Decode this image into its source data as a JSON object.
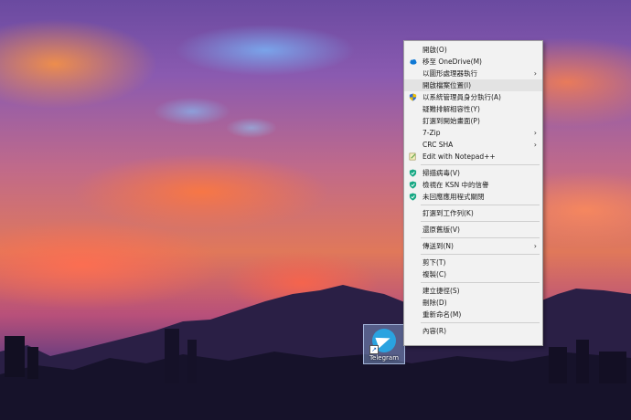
{
  "desktop": {
    "icon_label": "Telegram"
  },
  "context_menu": {
    "items": [
      {
        "label": "開啟(O)",
        "type": "item"
      },
      {
        "label": "移至 OneDrive(M)",
        "type": "item",
        "icon": "onedrive-cloud-icon"
      },
      {
        "label": "以圖形處理器執行",
        "type": "item",
        "submenu": true
      },
      {
        "label": "開啟檔案位置(I)",
        "type": "item",
        "highlight": true
      },
      {
        "label": "以系統管理員身分執行(A)",
        "type": "item",
        "icon": "uac-shield-icon"
      },
      {
        "label": "疑難排解相容性(Y)",
        "type": "item"
      },
      {
        "label": "釘選到開始畫面(P)",
        "type": "item"
      },
      {
        "label": "7-Zip",
        "type": "item",
        "submenu": true
      },
      {
        "label": "CRC SHA",
        "type": "item",
        "submenu": true
      },
      {
        "label": "Edit with Notepad++",
        "type": "item",
        "icon": "notepad-plus-plus-icon"
      },
      {
        "type": "separator"
      },
      {
        "label": "掃描病毒(V)",
        "type": "item",
        "icon": "kaspersky-shield-icon"
      },
      {
        "label": "檢視在 KSN 中的信譽",
        "type": "item",
        "icon": "kaspersky-shield-icon"
      },
      {
        "label": "未回應應用程式關閉",
        "type": "item",
        "icon": "kaspersky-shield-icon"
      },
      {
        "type": "separator"
      },
      {
        "label": "釘選到工作列(K)",
        "type": "item"
      },
      {
        "type": "separator"
      },
      {
        "label": "還原舊版(V)",
        "type": "item"
      },
      {
        "type": "separator"
      },
      {
        "label": "傳送到(N)",
        "type": "item",
        "submenu": true
      },
      {
        "type": "separator"
      },
      {
        "label": "剪下(T)",
        "type": "item"
      },
      {
        "label": "複製(C)",
        "type": "item"
      },
      {
        "type": "separator"
      },
      {
        "label": "建立捷徑(S)",
        "type": "item"
      },
      {
        "label": "刪除(D)",
        "type": "item"
      },
      {
        "label": "重新命名(M)",
        "type": "item"
      },
      {
        "type": "separator"
      },
      {
        "label": "內容(R)",
        "type": "item"
      }
    ],
    "submenu_arrow": "›"
  },
  "colors": {
    "onedrive": "#0f78d4",
    "uac_shield_blue": "#2d6ad6",
    "uac_shield_yellow": "#f2c200",
    "kaspersky": "#17a884",
    "telegram": "#2aa3e0"
  }
}
